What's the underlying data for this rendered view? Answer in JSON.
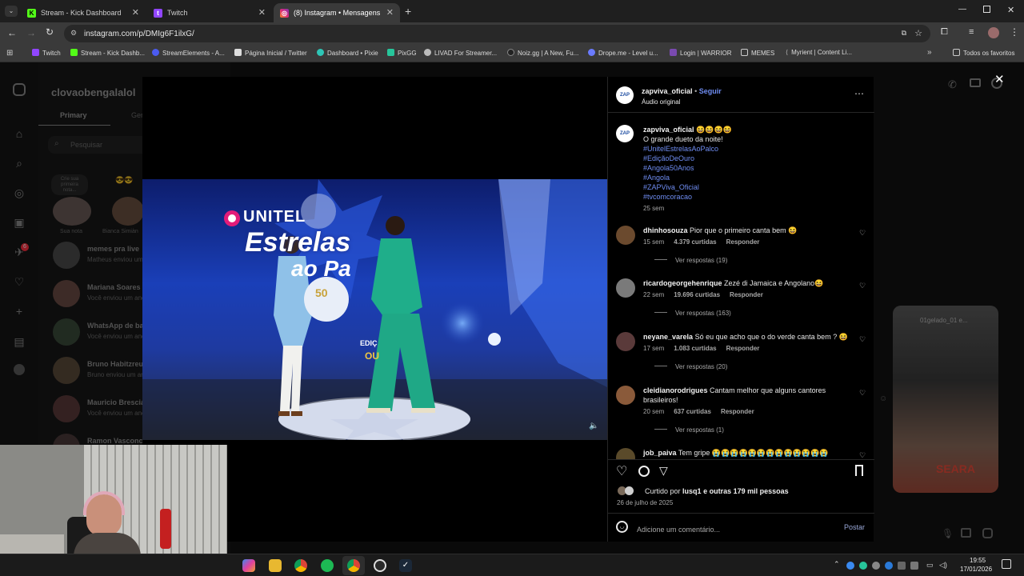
{
  "tabs": [
    {
      "label": "Stream - Kick Dashboard",
      "icon": "kick-icon",
      "color": "#53fc18"
    },
    {
      "label": "Twitch",
      "icon": "twitch-icon",
      "color": "#9146ff"
    },
    {
      "label": "(8) Instagram • Mensagens",
      "icon": "instagram-icon",
      "color": "#e1306c"
    }
  ],
  "address": {
    "url": "instagram.com/p/DMIg6F1ilxG/"
  },
  "bookmarks": [
    "Twitch",
    "Stream - Kick Dashb...",
    "StreamElements - A...",
    "Página Inicial / Twitter",
    "Dashboard • Pixie",
    "PixGG",
    "LIVAD For Streamer...",
    "Noiz.gg | A New, Fu...",
    "Drope.me - Level u...",
    "Login | WARRIOR",
    "MEMES",
    "Myrient | Content Li...",
    "Todos os favoritos"
  ],
  "dm": {
    "account": "clovaobengalalol",
    "tabs": [
      "Primary",
      "Ger"
    ],
    "search_placeholder": "Pesquisar",
    "note_text": "Crie sua primeira nota...",
    "note_labels": [
      "Sua nota",
      "Bianca Simiàn"
    ],
    "conversations": [
      {
        "name": "memes pra live",
        "sub": "Matheus enviou um ane..."
      },
      {
        "name": "Mariana Soares",
        "sub": "Você enviou um anexo"
      },
      {
        "name": "WhatsApp de bate",
        "sub": "Você enviou um anexo"
      },
      {
        "name": "Bruno Habitzreu",
        "sub": "Bruno enviou um anexo"
      },
      {
        "name": "Mauricio Bresciani",
        "sub": "Você enviou um anexo"
      },
      {
        "name": "Ramon Vasconc",
        "sub": ""
      }
    ],
    "notification_count": "6"
  },
  "video": {
    "brand": "UNITEL",
    "show_title": "Estrelas",
    "show_title_2": "ao Pa",
    "badge_number": "50",
    "badge_text": "INDEPENDÊNCIA NACIONAL DE ANGOLA",
    "badge_edition": "EDIÇ",
    "badge_ouro": "OU"
  },
  "post": {
    "author": "zapviva_oficial",
    "follow": "Seguir",
    "audio": "Áudio original",
    "caption_emojis": "😆😆😆😆",
    "caption": "O grande dueto da noite!",
    "hashtags": [
      "#UnitelEstrelasAoPalco",
      "#EdiçãoDeOuro",
      "#Angola50Anos",
      "#Angola",
      "#ZAPViva_Oficial",
      "#tvcomcoracao"
    ],
    "caption_age": "25 sem",
    "comments": [
      {
        "user": "dhinhosouza",
        "text": "Pior que o primeiro canta bem 😆",
        "age": "15 sem",
        "likes": "4.379 curtidas",
        "reply": "Responder",
        "replies": "Ver respostas (19)",
        "avatar": "#6b4a2e"
      },
      {
        "user": "ricardogeorgehenrique",
        "text": "Zezé di Jamaica e Angolano😆",
        "age": "22 sem",
        "likes": "19.696 curtidas",
        "reply": "Responder",
        "replies": "Ver respostas (163)",
        "avatar": "#7a7a7a"
      },
      {
        "user": "neyane_varela",
        "text": "Só eu que acho que o do verde canta bem ? 😆",
        "age": "17 sem",
        "likes": "1.083 curtidas",
        "reply": "Responder",
        "replies": "Ver respostas (20)",
        "avatar": "#5a3a3a"
      },
      {
        "user": "cleidianorodrigues",
        "text": "Cantam melhor que alguns cantores brasileiros!",
        "age": "20 sem",
        "likes": "637 curtidas",
        "reply": "Responder",
        "replies": "Ver respostas (1)",
        "avatar": "#8a5a3a"
      },
      {
        "user": "job_paiva",
        "text": "Tem gripe 😭😭😭😭😭😭😭😭😭😭😭😭😭",
        "age": "",
        "likes": "",
        "reply": "",
        "replies": "",
        "avatar": "#5a4a2a"
      }
    ],
    "liked_by_prefix": "Curtido por",
    "liked_by_user": "lusq1",
    "liked_by_suffix": "e outras 179 mil pessoas",
    "date": "26 de julho de 2025",
    "comment_placeholder": "Adicione um comentário...",
    "post_button": "Postar"
  },
  "background_card": {
    "user": "01gelado_01 e...",
    "label": "SEARA"
  },
  "taskbar": {
    "time": "19:55",
    "date": "17/01/2026"
  }
}
